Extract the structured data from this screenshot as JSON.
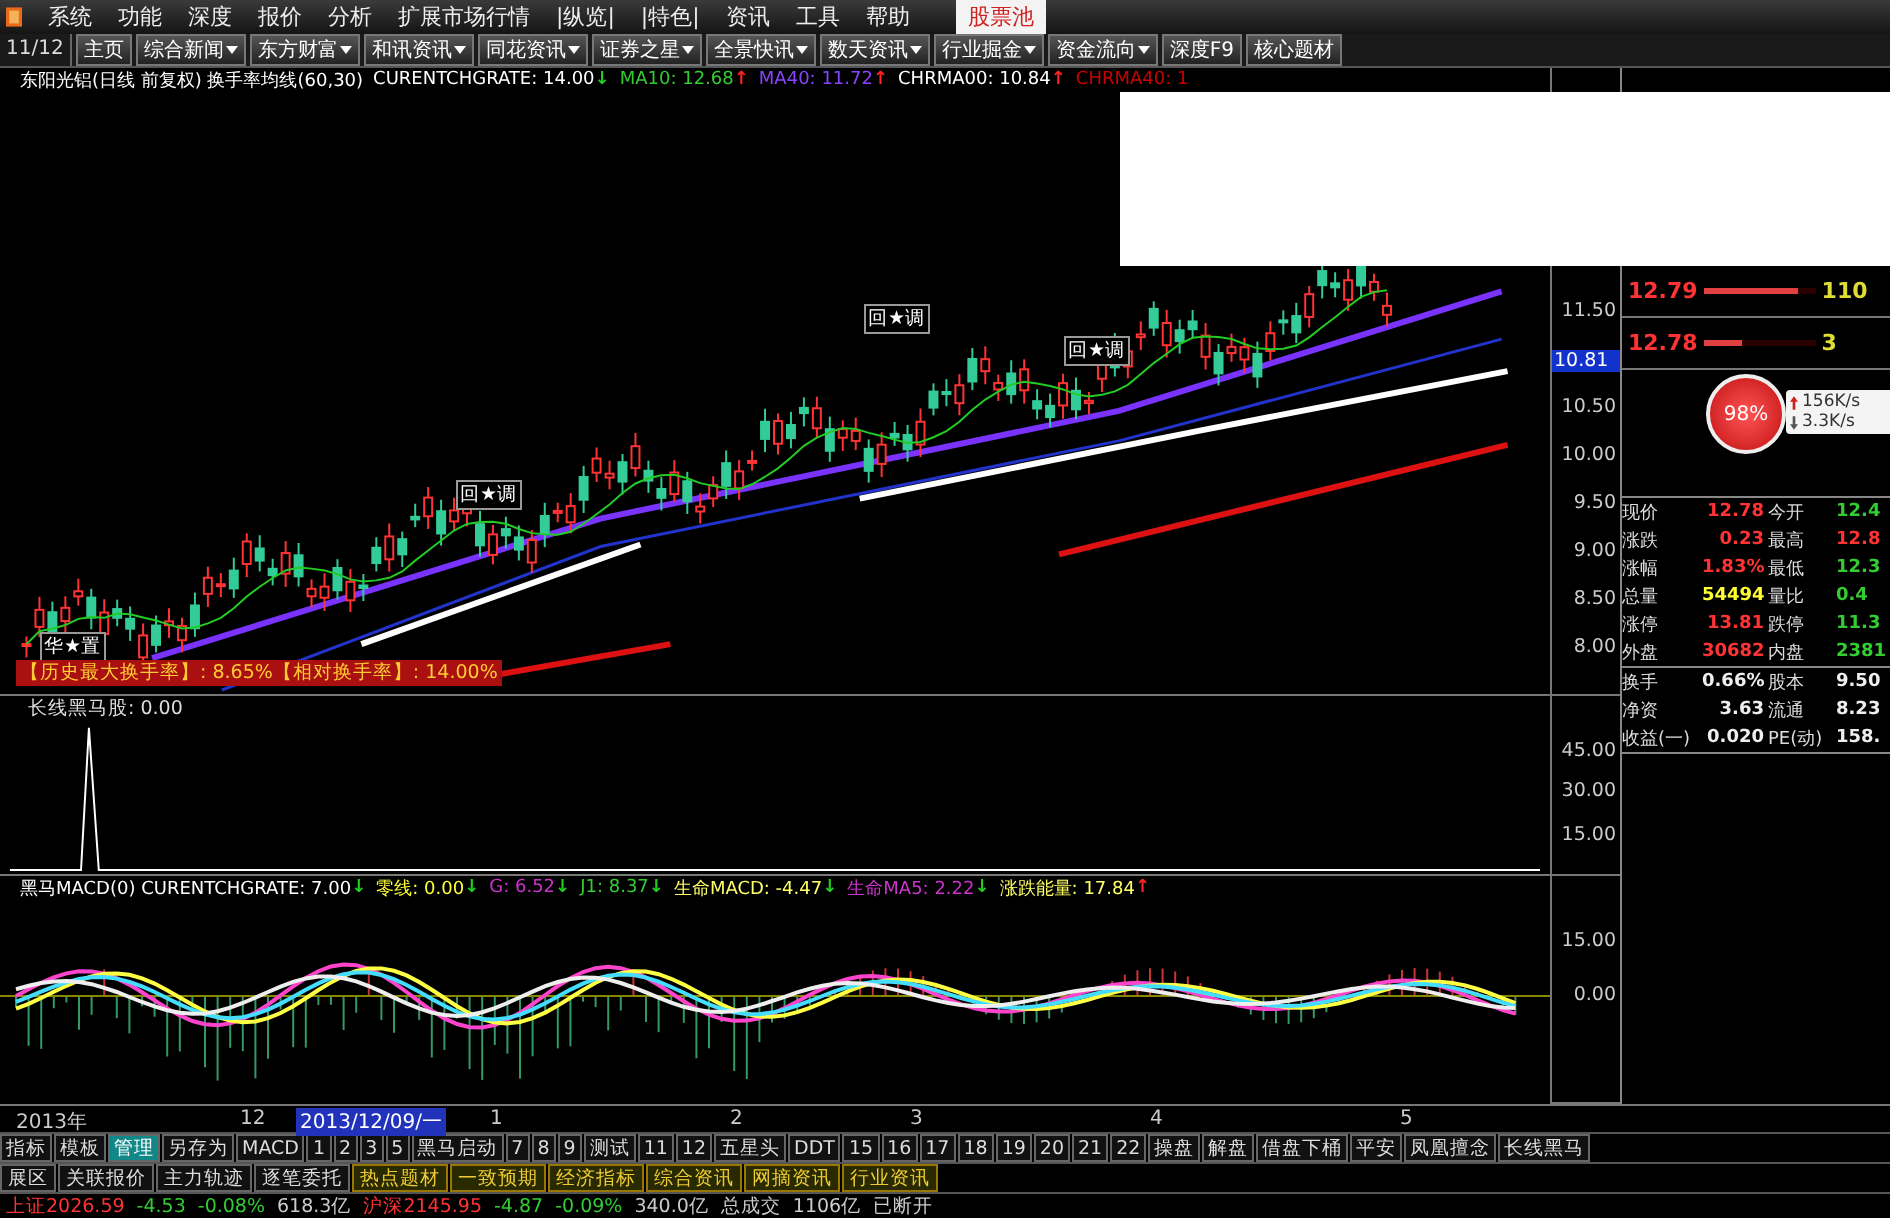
{
  "menu": {
    "items": [
      "系统",
      "功能",
      "深度",
      "报价",
      "分析",
      "扩展市场行情",
      "|纵览|",
      "|特色|",
      "资讯",
      "工具",
      "帮助"
    ],
    "badge": "股票池"
  },
  "toolbar": {
    "page": "11/12",
    "items": [
      {
        "label": "主页",
        "dropdown": false
      },
      {
        "label": "综合新闻",
        "dropdown": true
      },
      {
        "label": "东方财富",
        "dropdown": true
      },
      {
        "label": "和讯资讯",
        "dropdown": true
      },
      {
        "label": "同花资讯",
        "dropdown": true
      },
      {
        "label": "证券之星",
        "dropdown": true
      },
      {
        "label": "全景快讯",
        "dropdown": true
      },
      {
        "label": "数天资讯",
        "dropdown": true
      },
      {
        "label": "行业掘金",
        "dropdown": true
      },
      {
        "label": "资金流向",
        "dropdown": true
      },
      {
        "label": "深度F9",
        "dropdown": false
      },
      {
        "label": "核心题材",
        "dropdown": false
      }
    ]
  },
  "price_chart": {
    "legend": [
      {
        "text": "东阳光铝(日线 前复权) 换手率均线(60,30)",
        "color": "#ffffff"
      },
      {
        "text": "CURENTCHGRATE: 14.00",
        "color": "#ffffff",
        "arrow": {
          "symbol": "↓",
          "color": "#22cc22"
        }
      },
      {
        "text": "MA10: 12.68",
        "color": "#33cc33",
        "arrow": {
          "symbol": "↑",
          "color": "#ff2222"
        }
      },
      {
        "text": "MA40: 11.72",
        "color": "#8844ff",
        "arrow": {
          "symbol": "↑",
          "color": "#ff2222"
        }
      },
      {
        "text": "CHRMA00: 10.84",
        "color": "#ffffff",
        "arrow": {
          "symbol": "↑",
          "color": "#ff2222"
        }
      },
      {
        "text": "CHRMA40: 1",
        "color": "#cc0000"
      }
    ],
    "markers": [
      "华★置",
      "回★调",
      "回★调",
      "回★调"
    ],
    "info_bar": "【历史最大换手率】: 8.65%【相对换手率】: 14.00%",
    "axis": [
      "11.50",
      "10.50",
      "10.00",
      "9.50",
      "9.00",
      "8.50",
      "8.00"
    ],
    "current_price": "10.81"
  },
  "turnover_panel": {
    "legend": "长线黑马股: 0.00",
    "axis": [
      "45.00",
      "30.00",
      "15.00"
    ]
  },
  "macd_panel": {
    "legend": [
      {
        "text": "黑马MACD(0) CURENTCHGRATE: 7.00",
        "color": "#ffffff",
        "arrow": {
          "symbol": "↓",
          "color": "#22cc22"
        }
      },
      {
        "text": "零线: 0.00",
        "color": "#ffff33",
        "arrow": {
          "symbol": "↓",
          "color": "#22cc22"
        }
      },
      {
        "text": "G: 6.52",
        "color": "#cc33cc",
        "arrow": {
          "symbol": "↓",
          "color": "#22cc22"
        }
      },
      {
        "text": "J1: 8.37",
        "color": "#33cc33",
        "arrow": {
          "symbol": "↓",
          "color": "#22cc22"
        }
      },
      {
        "text": "生命MACD: -4.47",
        "color": "#ffff66",
        "arrow": {
          "symbol": "↓",
          "color": "#22cc22"
        }
      },
      {
        "text": "生命MA5: 2.22",
        "color": "#cc33cc",
        "arrow": {
          "symbol": "↓",
          "color": "#22cc22"
        }
      },
      {
        "text": "涨跌能量: 17.84",
        "color": "#ffff66",
        "arrow": {
          "symbol": "↑",
          "color": "#ff2222"
        }
      }
    ],
    "axis": [
      "15.00",
      "0.00"
    ]
  },
  "time_axis": [
    {
      "label": "2013年",
      "selected": false
    },
    {
      "label": "12",
      "selected": false
    },
    {
      "label": "2013/12/09/一",
      "selected": true
    },
    {
      "label": "1",
      "selected": false
    },
    {
      "label": "2",
      "selected": false
    },
    {
      "label": "3",
      "selected": false
    },
    {
      "label": "4",
      "selected": false
    },
    {
      "label": "5",
      "selected": false
    }
  ],
  "order_book": [
    {
      "price": "12.79",
      "volume": "110",
      "level": 0.85
    },
    {
      "price": "12.78",
      "volume": "3",
      "level": 0.35
    }
  ],
  "speed_badge": {
    "percent": "98%",
    "up": "156K/s",
    "down": "3.3K/s"
  },
  "quote": [
    [
      {
        "label": "现价",
        "value": "12.78",
        "color": "#ff3333"
      },
      {
        "label": "今开",
        "value": "12.4",
        "color": "#33cc33"
      }
    ],
    [
      {
        "label": "涨跌",
        "value": "0.23",
        "color": "#ff3333"
      },
      {
        "label": "最高",
        "value": "12.8",
        "color": "#ff3333"
      }
    ],
    [
      {
        "label": "涨幅",
        "value": "1.83%",
        "color": "#ff3333"
      },
      {
        "label": "最低",
        "value": "12.3",
        "color": "#33cc33"
      }
    ],
    [
      {
        "label": "总量",
        "value": "54494",
        "color": "#ffff33"
      },
      {
        "label": "量比",
        "value": "0.4",
        "color": "#33cc33"
      }
    ],
    [
      {
        "label": "涨停",
        "value": "13.81",
        "color": "#ff3333"
      },
      {
        "label": "跌停",
        "value": "11.3",
        "color": "#33cc33"
      }
    ],
    [
      {
        "label": "外盘",
        "value": "30682",
        "color": "#ff3333"
      },
      {
        "label": "内盘",
        "value": "2381",
        "color": "#33cc33"
      }
    ]
  ],
  "fundamentals": [
    {
      "label": "换手",
      "value": "0.66%",
      "label2": "股本",
      "value2": "9.50"
    },
    {
      "label": "净资",
      "value": "3.63",
      "label2": "流通",
      "value2": "8.23"
    },
    {
      "label": "收益(一)",
      "value": "0.020",
      "label2": "PE(动)",
      "value2": "158."
    }
  ],
  "indicator_tabs": [
    {
      "label": "指标",
      "selected": false
    },
    {
      "label": "模板",
      "selected": false
    },
    {
      "label": "管理",
      "selected": true
    },
    {
      "label": "另存为",
      "selected": false
    },
    {
      "label": "MACD",
      "selected": false
    },
    {
      "label": "1",
      "selected": false
    },
    {
      "label": "2",
      "selected": false
    },
    {
      "label": "3",
      "selected": false
    },
    {
      "label": "5",
      "selected": false
    },
    {
      "label": "黑马启动",
      "selected": false
    },
    {
      "label": "7",
      "selected": false
    },
    {
      "label": "8",
      "selected": false
    },
    {
      "label": "9",
      "selected": false
    },
    {
      "label": "测试",
      "selected": false
    },
    {
      "label": "11",
      "selected": false
    },
    {
      "label": "12",
      "selected": false
    },
    {
      "label": "五星头",
      "selected": false
    },
    {
      "label": "DDT",
      "selected": false
    },
    {
      "label": "15",
      "selected": false
    },
    {
      "label": "16",
      "selected": false
    },
    {
      "label": "17",
      "selected": false
    },
    {
      "label": "18",
      "selected": false
    },
    {
      "label": "19",
      "selected": false
    },
    {
      "label": "20",
      "selected": false
    },
    {
      "label": "21",
      "selected": false
    },
    {
      "label": "22",
      "selected": false
    },
    {
      "label": "操盘",
      "selected": false
    },
    {
      "label": "解盘",
      "selected": false
    },
    {
      "label": "借盘下桶",
      "selected": false
    },
    {
      "label": "平安",
      "selected": false
    },
    {
      "label": "凤凰擅念",
      "selected": false
    },
    {
      "label": "长线黑马",
      "selected": false
    }
  ],
  "ext_tabs": [
    {
      "label": "展区",
      "kind": "plain"
    },
    {
      "label": "关联报价",
      "kind": "plain"
    },
    {
      "label": "主力轨迹",
      "kind": "plain"
    },
    {
      "label": "逐笔委托",
      "kind": "plain"
    },
    {
      "label": "热点题材",
      "kind": "info"
    },
    {
      "label": "一致预期",
      "kind": "info"
    },
    {
      "label": "经济指标",
      "kind": "info"
    },
    {
      "label": "综合资讯",
      "kind": "info"
    },
    {
      "label": "网摘资讯",
      "kind": "info"
    },
    {
      "label": "行业资讯",
      "kind": "info"
    }
  ],
  "status_bar": [
    {
      "text": "上证2026.59",
      "color": "#ff3333"
    },
    {
      "text": "-4.53",
      "color": "#33cc33"
    },
    {
      "text": "-0.08%",
      "color": "#33cc33"
    },
    {
      "text": "618.3亿",
      "color": "#cccccc"
    },
    {
      "text": "沪深2145.95",
      "color": "#ff3333"
    },
    {
      "text": "-4.87",
      "color": "#33cc33"
    },
    {
      "text": "-0.09%",
      "color": "#33cc33"
    },
    {
      "text": "340.0亿",
      "color": "#cccccc"
    },
    {
      "text": "总成交",
      "color": "#cccccc"
    },
    {
      "text": "1106亿",
      "color": "#cccccc"
    },
    {
      "text": "已断开",
      "color": "#cccccc"
    }
  ]
}
